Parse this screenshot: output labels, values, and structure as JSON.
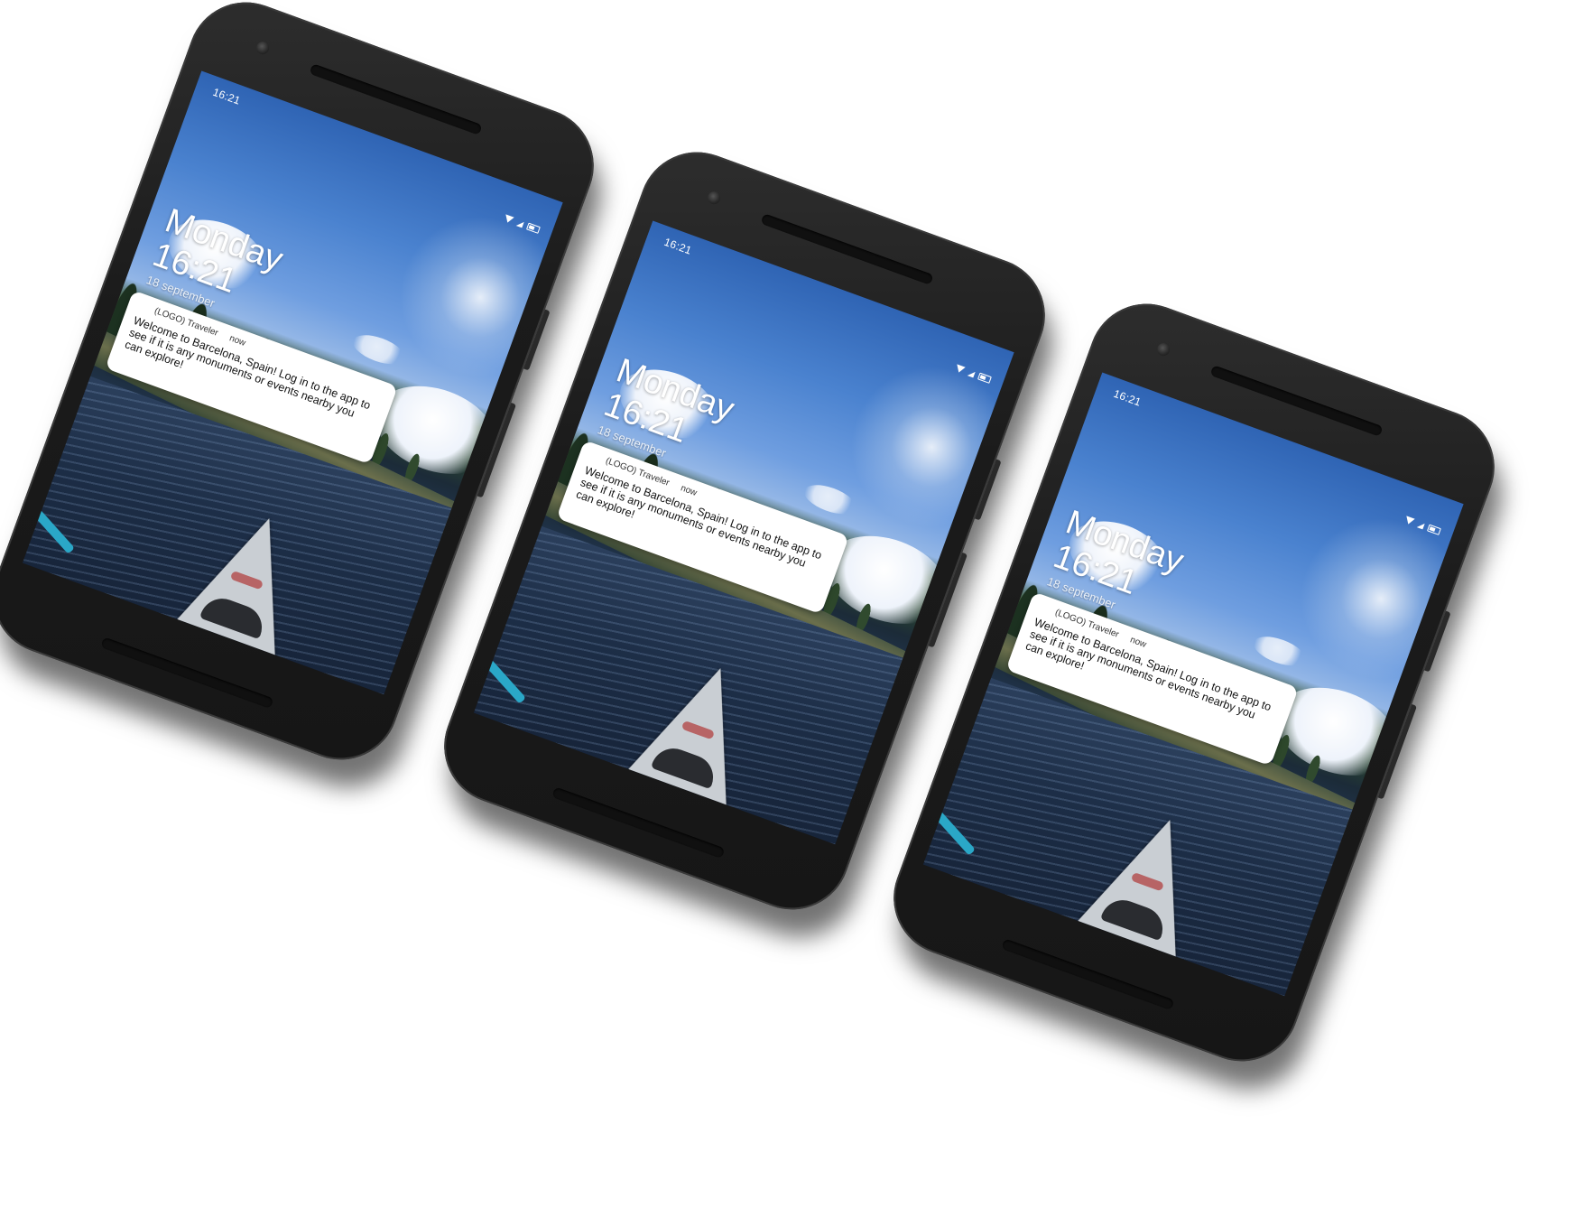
{
  "phones": [
    {
      "status_time": "16:21",
      "lock_day": "Monday",
      "lock_time": "16:21",
      "lock_date": "18 september",
      "notification": {
        "app": "(LOGO) Traveler",
        "when": "now",
        "message": "Welcome to Barcelona, Spain! Log in to the app to see if it is any monuments or events nearby you can explore!"
      }
    },
    {
      "status_time": "16:21",
      "lock_day": "Monday",
      "lock_time": "16:21",
      "lock_date": "18 september",
      "notification": {
        "app": "(LOGO) Traveler",
        "when": "now",
        "message": "Welcome to Barcelona, Spain! Log in to the app to see if it is any monuments or events nearby you can explore!"
      }
    },
    {
      "status_time": "16:21",
      "lock_day": "Monday",
      "lock_time": "16:21",
      "lock_date": "18 september",
      "notification": {
        "app": "(LOGO) Traveler",
        "when": "now",
        "message": "Welcome to Barcelona, Spain! Log in to the app to see if it is any monuments or events nearby you can explore!"
      }
    }
  ],
  "icons": {
    "status": [
      "wifi-icon",
      "signal-icon",
      "battery-icon"
    ]
  },
  "colors": {
    "phone_body": "#1b1b1b",
    "sky": "#4a82cf",
    "notification_bg": "#ffffff"
  }
}
